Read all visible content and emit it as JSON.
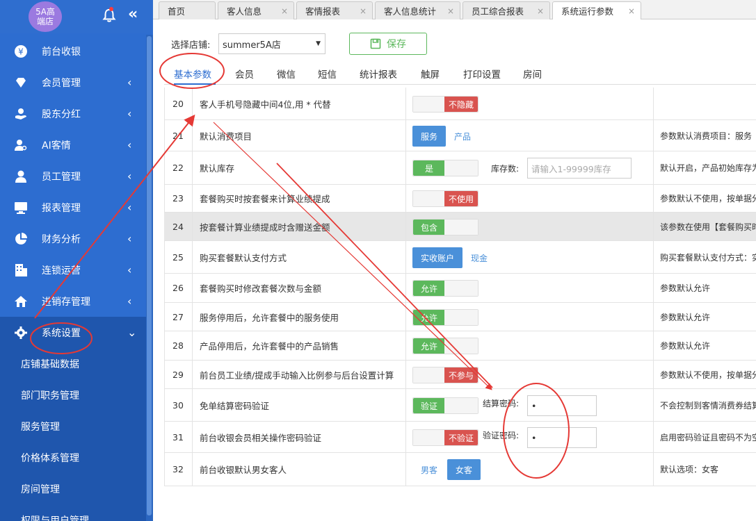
{
  "sidebar": {
    "logo_text": "5A高端店",
    "menu": [
      {
        "label": "前台收银",
        "arrow": "",
        "icon": "yen-icon"
      },
      {
        "label": "会员管理",
        "arrow": "‹",
        "icon": "diamond-icon"
      },
      {
        "label": "股东分红",
        "arrow": "‹",
        "icon": "hand-coin-icon"
      },
      {
        "label": "AI客情",
        "arrow": "‹",
        "icon": "user-search-icon"
      },
      {
        "label": "员工管理",
        "arrow": "‹",
        "icon": "user-icon"
      },
      {
        "label": "报表管理",
        "arrow": "‹",
        "icon": "monitor-icon"
      },
      {
        "label": "财务分析",
        "arrow": "‹",
        "icon": "pie-icon"
      },
      {
        "label": "连锁运营",
        "arrow": "‹",
        "icon": "building-icon"
      },
      {
        "label": "进销存管理",
        "arrow": "‹",
        "icon": "house-icon"
      },
      {
        "label": "系统设置",
        "arrow": "⌄",
        "icon": "gear-icon"
      }
    ],
    "submenu": [
      "店铺基础数据",
      "部门职务管理",
      "服务管理",
      "价格体系管理",
      "房间管理",
      "权限与用户管理"
    ]
  },
  "tabs": [
    {
      "label": "首页",
      "closable": false
    },
    {
      "label": "客人信息",
      "closable": true
    },
    {
      "label": "客情报表",
      "closable": true
    },
    {
      "label": "客人信息统计",
      "closable": true
    },
    {
      "label": "员工综合报表",
      "closable": true
    },
    {
      "label": "系统运行参数",
      "closable": true
    }
  ],
  "store": {
    "label": "选择店铺:",
    "value": "summer5A店"
  },
  "save_label": "保存",
  "subtabs": [
    "基本参数",
    "会员",
    "微信",
    "短信",
    "统计报表",
    "触屏",
    "打印设置",
    "房间"
  ],
  "rows": [
    {
      "no": "20",
      "name": "客人手机号隐藏中间4位,用 * 代替",
      "type": "toggle",
      "state": "off",
      "text": "不隐藏",
      "desc": ""
    },
    {
      "no": "21",
      "name": "默认消费项目",
      "type": "choice",
      "options": [
        "服务",
        "产品"
      ],
      "selected": 0,
      "desc": "参数默认消费项目：服务"
    },
    {
      "no": "22",
      "name": "默认库存",
      "type": "toggle",
      "state": "on",
      "text": "是",
      "extra_label": "库存数:",
      "extra_placeholder": "请输入1-99999库存",
      "desc": "默认开启，产品初始库存为"
    },
    {
      "no": "23",
      "name": "套餐购买时按套餐来计算业绩提成",
      "type": "toggle",
      "state": "off",
      "text": "不使用",
      "desc": "参数默认不使用，按单据分"
    },
    {
      "no": "24",
      "name": "按套餐计算业绩提成时含赠送金额",
      "type": "toggle",
      "state": "on",
      "text": "包含",
      "desc": "该参数在使用【套餐购买时"
    },
    {
      "no": "25",
      "name": "购买套餐默认支付方式",
      "type": "choice",
      "options": [
        "实收账户",
        "现金"
      ],
      "selected": 0,
      "desc": "购买套餐默认支付方式：实"
    },
    {
      "no": "26",
      "name": "套餐购买时修改套餐次数与金额",
      "type": "toggle",
      "state": "on",
      "text": "允许",
      "desc": "参数默认允许"
    },
    {
      "no": "27",
      "name": "服务停用后，允许套餐中的服务使用",
      "type": "toggle",
      "state": "on",
      "text": "允许",
      "desc": "参数默认允许"
    },
    {
      "no": "28",
      "name": "产品停用后，允许套餐中的产品销售",
      "type": "toggle",
      "state": "on",
      "text": "允许",
      "desc": "参数默认允许"
    },
    {
      "no": "29",
      "name": "前台员工业绩/提成手动输入比例参与后台设置计算",
      "type": "toggle",
      "state": "off",
      "text": "不参与",
      "desc": "参数默认不使用，按单据分"
    },
    {
      "no": "30",
      "name": "免单结算密码验证",
      "type": "toggle",
      "state": "on",
      "text": "验证",
      "extra_label": "结算密码:",
      "extra_value": "•",
      "desc": "不会控制到客情消费券结算"
    },
    {
      "no": "31",
      "name": "前台收银会员相关操作密码验证",
      "type": "toggle",
      "state": "off",
      "text": "不验证",
      "extra_label": "验证密码:",
      "extra_value": "•",
      "desc": "启用密码验证且密码不为空"
    },
    {
      "no": "32",
      "name": "前台收银默认男女客人",
      "type": "choice",
      "options": [
        "男客",
        "女客"
      ],
      "selected": 1,
      "desc": "默认选项：女客"
    }
  ],
  "colors": {
    "sidebar": "#2d6dd0",
    "sidebar_active": "#1f56ad",
    "on": "#5cb85c",
    "off": "#d9534f",
    "blue_btn": "#4a90d9",
    "annotation": "#e53935"
  }
}
